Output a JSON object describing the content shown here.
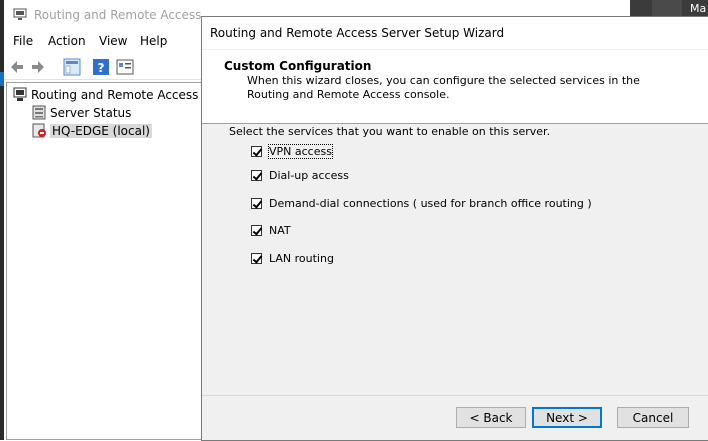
{
  "mmc": {
    "title": "Routing and Remote Access",
    "menu": [
      "File",
      "Action",
      "View",
      "Help"
    ],
    "tree": {
      "root": "Routing and Remote Access",
      "children": [
        "Server Status",
        "HQ-EDGE (local)"
      ]
    }
  },
  "desktop": {
    "corner_text": "Ma"
  },
  "wizard": {
    "title": "Routing and Remote Access Server Setup Wizard",
    "header_title": "Custom Configuration",
    "header_desc": "When this wizard closes, you can configure the selected services in the Routing and Remote Access console.",
    "intro": "Select the services that you want to enable on this server.",
    "options": [
      {
        "label": "VPN access",
        "checked": true
      },
      {
        "label": "Dial-up access",
        "checked": true
      },
      {
        "label": "Demand-dial connections ( used for branch office routing )",
        "checked": true
      },
      {
        "label": "NAT",
        "checked": true
      },
      {
        "label": "LAN routing",
        "checked": true
      }
    ],
    "buttons": {
      "back": "< Back",
      "next": "Next >",
      "cancel": "Cancel"
    }
  },
  "colors": {
    "accent": "#0078d7",
    "dialog_bg": "#f0f0f0"
  }
}
